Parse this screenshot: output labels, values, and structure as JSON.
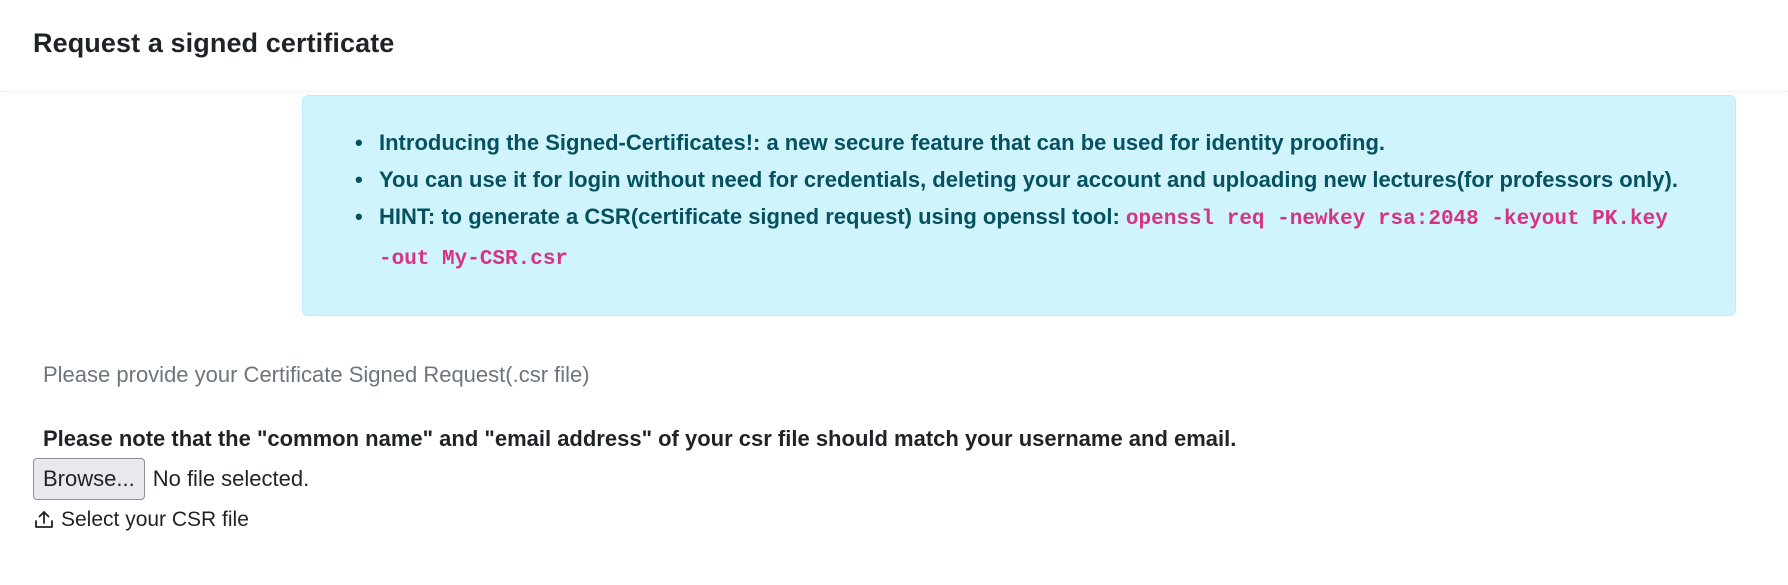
{
  "page": {
    "title": "Request a signed certificate"
  },
  "alert": {
    "items": [
      {
        "text": "Introducing the Signed-Certificates!: a new secure feature that can be used for identity proofing."
      },
      {
        "text": "You can use it for login without need for credentials, deleting your account and uploading new lectures(for professors only)."
      },
      {
        "text": "HINT: to generate a CSR(certificate signed request) using openssl tool: ",
        "code_line1": "openssl req -newkey rsa:2048 -keyout PK.key",
        "code_line2": "-out My-CSR.csr"
      }
    ],
    "color_bg": "#cff4fc",
    "color_text": "#055160",
    "color_code": "#d63384"
  },
  "form": {
    "provide_label": "Please provide your Certificate Signed Request(.csr file)",
    "note": "Please note that the \"common name\" and \"email address\" of your csr file should match your username and email.",
    "browse_label": "Browse...",
    "file_status": "No file selected.",
    "select_label": "Select your CSR file",
    "select_icon": "upload-icon"
  }
}
